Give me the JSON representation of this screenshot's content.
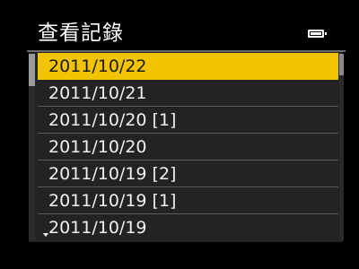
{
  "header": {
    "title": "查看記錄",
    "battery_icon": "battery-full-icon"
  },
  "colors": {
    "background": "#000000",
    "list_background": "#232323",
    "selection": "#f2c400",
    "text": "#f0f0f0",
    "selected_text": "#1a1a1a"
  },
  "list": {
    "selected_index": 0,
    "items": [
      {
        "label": "2011/10/22"
      },
      {
        "label": "2011/10/21"
      },
      {
        "label": "2011/10/20 [1]"
      },
      {
        "label": "2011/10/20"
      },
      {
        "label": "2011/10/19 [2]"
      },
      {
        "label": "2011/10/19 [1]"
      },
      {
        "label": "2011/10/19"
      }
    ],
    "more_below_icon": "triangle-down-icon"
  }
}
